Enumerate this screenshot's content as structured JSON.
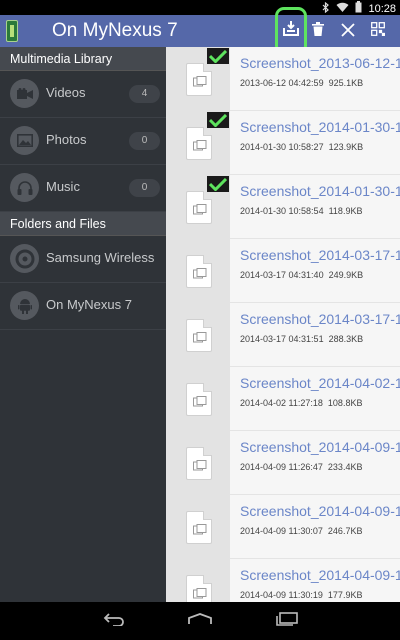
{
  "status_bar": {
    "time": "10:28",
    "icons": [
      "bluetooth-icon",
      "wifi-icon",
      "battery-icon"
    ]
  },
  "action_bar": {
    "title": "On MyNexus 7",
    "actions": [
      "download-to-device-icon",
      "trash-icon",
      "close-icon",
      "qr-icon"
    ],
    "highlight_color": "#5ee35e",
    "bar_color": "#5568a9"
  },
  "sidebar": {
    "multimedia_header": "Multimedia Library",
    "library_items": [
      {
        "label": "Videos",
        "count": "4",
        "icon": "video-camera-icon"
      },
      {
        "label": "Photos",
        "count": "0",
        "icon": "photo-icon"
      },
      {
        "label": "Music",
        "count": "0",
        "icon": "headphones-icon"
      }
    ],
    "folders_header": "Folders and Files",
    "folder_items": [
      {
        "label": "Samsung Wireless",
        "icon": "disc-icon"
      },
      {
        "label": "On MyNexus 7",
        "icon": "android-icon"
      }
    ]
  },
  "files": [
    {
      "name": "Screenshot_2013-06-12-1",
      "date": "2013-06-12 04:42:59",
      "size": "925.1KB",
      "checked": true
    },
    {
      "name": "Screenshot_2014-01-30-1",
      "date": "2014-01-30 10:58:27",
      "size": "123.9KB",
      "checked": true
    },
    {
      "name": "Screenshot_2014-01-30-1",
      "date": "2014-01-30 10:58:54",
      "size": "118.9KB",
      "checked": true
    },
    {
      "name": "Screenshot_2014-03-17-1",
      "date": "2014-03-17 04:31:40",
      "size": "249.9KB",
      "checked": false
    },
    {
      "name": "Screenshot_2014-03-17-1",
      "date": "2014-03-17 04:31:51",
      "size": "288.3KB",
      "checked": false
    },
    {
      "name": "Screenshot_2014-04-02-1",
      "date": "2014-04-02 11:27:18",
      "size": "108.8KB",
      "checked": false
    },
    {
      "name": "Screenshot_2014-04-09-1",
      "date": "2014-04-09 11:26:47",
      "size": "233.4KB",
      "checked": false
    },
    {
      "name": "Screenshot_2014-04-09-1",
      "date": "2014-04-09 11:30:07",
      "size": "246.7KB",
      "checked": false
    },
    {
      "name": "Screenshot_2014-04-09-1",
      "date": "2014-04-09 11:30:19",
      "size": "177.9KB",
      "checked": false
    }
  ],
  "nav_bar": {
    "buttons": [
      "back-icon",
      "home-icon",
      "recents-icon"
    ]
  }
}
